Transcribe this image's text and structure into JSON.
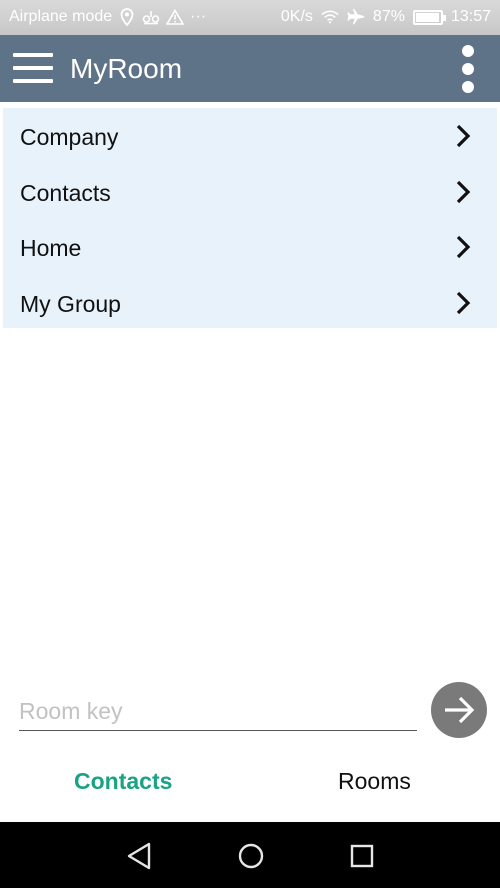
{
  "status_bar": {
    "airplane_label": "Airplane mode",
    "ellipsis": "···",
    "speed": "0K/s",
    "battery_percent": "87%",
    "battery_level": 0.87,
    "time": "13:57",
    "icons": [
      "location-icon",
      "sim-icon",
      "warning-icon",
      "wifi-icon",
      "airplane-icon",
      "battery-icon"
    ]
  },
  "app_bar": {
    "title": "MyRoom",
    "color": "#5f7388"
  },
  "list": {
    "items": [
      {
        "label": "Company"
      },
      {
        "label": "Contacts"
      },
      {
        "label": "Home"
      },
      {
        "label": "My Group"
      }
    ],
    "background": "#e7f2fb"
  },
  "room_key": {
    "placeholder": "Room key",
    "value": ""
  },
  "tabs": {
    "contacts": "Contacts",
    "rooms": "Rooms",
    "active": "contacts",
    "active_color": "#1aa383"
  },
  "nav_bar": {
    "icons": [
      "back-icon",
      "home-icon",
      "recents-icon"
    ]
  }
}
